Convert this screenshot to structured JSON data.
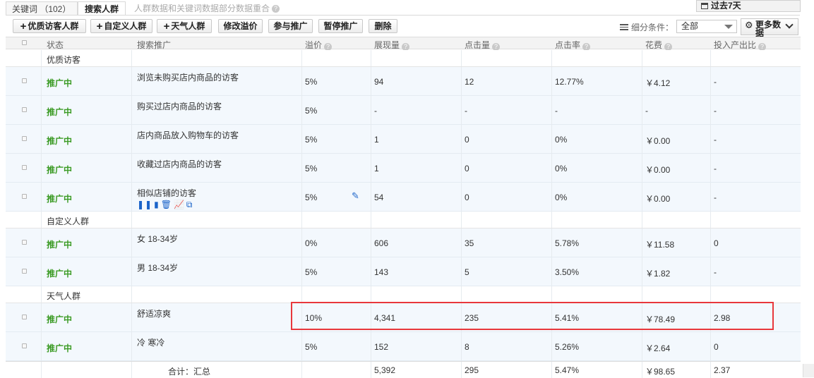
{
  "tabs": {
    "keywords": "关键词 （102）",
    "crowd": "搜索人群",
    "note": "人群数据和关键词数据部分数据重合",
    "note_icon": "question-icon"
  },
  "period": {
    "label": "过去7天",
    "icon": "calendar-icon"
  },
  "toolbar": {
    "add_quality": "优质访客人群",
    "add_custom": "自定义人群",
    "add_weather": "天气人群",
    "edit_premium": "修改溢价",
    "join_promo": "参与推广",
    "pause_promo": "暂停推广",
    "delete": "删除",
    "filter_label": "细分条件：",
    "filter_value": "全部",
    "more_label": "更多数据"
  },
  "columns": {
    "status": "状态",
    "name": "搜索推广",
    "premium": "溢价",
    "impressions": "展现量",
    "clicks": "点击量",
    "ctr": "点击率",
    "cost": "花费",
    "roi": "投入产出比"
  },
  "groups": [
    {
      "title": "优质访客",
      "rows": [
        {
          "status": "推广中",
          "name": "浏览未购买店内商品的访客",
          "premium": "5%",
          "impressions": "94",
          "clicks": "12",
          "ctr": "12.77%",
          "cost": "￥4.12",
          "roi": "-"
        },
        {
          "status": "推广中",
          "name": "购买过店内商品的访客",
          "premium": "5%",
          "impressions": "-",
          "clicks": "-",
          "ctr": "-",
          "cost": "-",
          "roi": "-"
        },
        {
          "status": "推广中",
          "name": "店内商品放入购物车的访客",
          "premium": "5%",
          "impressions": "1",
          "clicks": "0",
          "ctr": "0%",
          "cost": "￥0.00",
          "roi": "-"
        },
        {
          "status": "推广中",
          "name": "收藏过店内商品的访客",
          "premium": "5%",
          "impressions": "1",
          "clicks": "0",
          "ctr": "0%",
          "cost": "￥0.00",
          "roi": "-"
        },
        {
          "status": "推广中",
          "name": "相似店铺的访客",
          "premium": "5%",
          "impressions": "54",
          "clicks": "0",
          "ctr": "0%",
          "cost": "￥0.00",
          "roi": "-"
        }
      ]
    },
    {
      "title": "自定义人群",
      "rows": [
        {
          "status": "推广中",
          "name": "女 18-34岁",
          "premium": "0%",
          "impressions": "606",
          "clicks": "35",
          "ctr": "5.78%",
          "cost": "￥11.58",
          "roi": "0"
        },
        {
          "status": "推广中",
          "name": "男 18-34岁",
          "premium": "5%",
          "impressions": "143",
          "clicks": "5",
          "ctr": "3.50%",
          "cost": "￥1.82",
          "roi": "-"
        }
      ]
    },
    {
      "title": "天气人群",
      "rows": [
        {
          "status": "推广中",
          "name": "舒适凉爽",
          "premium": "10%",
          "impressions": "4,341",
          "clicks": "235",
          "ctr": "5.41%",
          "cost": "￥78.49",
          "roi": "2.98"
        },
        {
          "status": "推广中",
          "name": "冷 寒冷",
          "premium": "5%",
          "impressions": "152",
          "clicks": "8",
          "ctr": "5.26%",
          "cost": "￥2.64",
          "roi": "0"
        }
      ]
    }
  ],
  "total": {
    "label": "合计：汇总",
    "impressions": "5,392",
    "clicks": "295",
    "ctr": "5.47%",
    "cost": "￥98.65",
    "roi": "2.37"
  },
  "row_ops_icons": [
    "pause-icon",
    "report-icon",
    "delete-icon",
    "trend-icon",
    "copy-icon"
  ],
  "row_ops_glyphs": [
    "❚❚",
    "▮",
    "🗑",
    "📈",
    "⧉"
  ],
  "highlight_color": "#e8383c",
  "status_color": "#3a9a23"
}
